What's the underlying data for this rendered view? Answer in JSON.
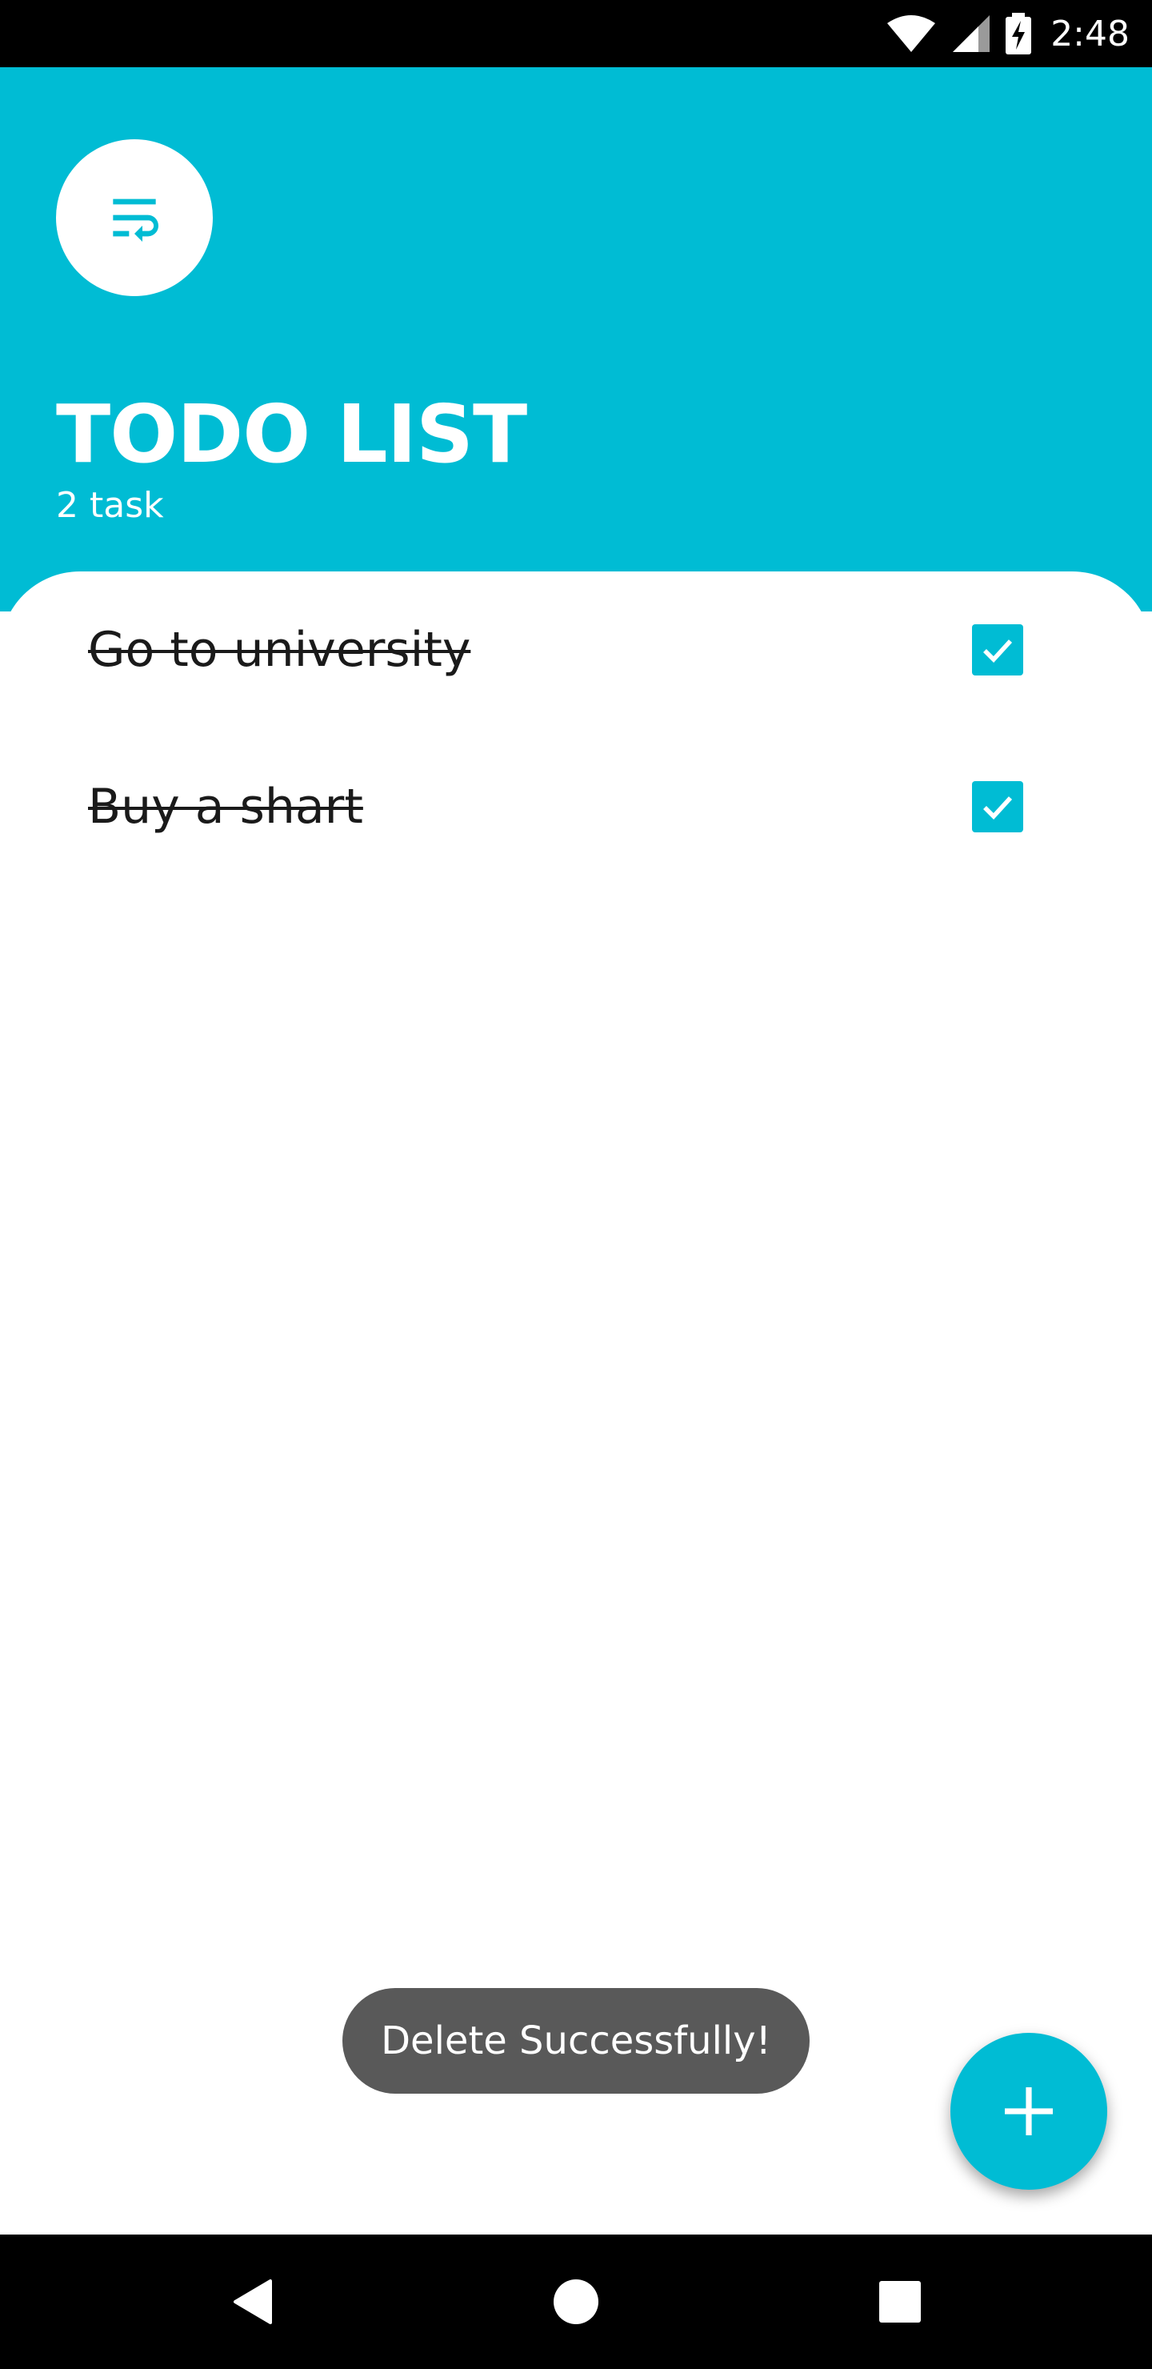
{
  "status_bar": {
    "time": "2:48",
    "icons": [
      "wifi-icon",
      "cellular-signal-icon",
      "battery-charging-icon"
    ]
  },
  "header": {
    "app_icon": "wrap-text-icon",
    "title": "TODO LIST",
    "task_count": "2 task",
    "accent_color": "#00bcd4"
  },
  "tasks": [
    {
      "label": "Go to university",
      "done": true
    },
    {
      "label": "Buy a shart",
      "done": true
    }
  ],
  "toast": {
    "message": "Delete Successfully!"
  },
  "fab": {
    "icon": "plus-icon"
  },
  "nav_bar": {
    "buttons": [
      "back-icon",
      "home-icon",
      "recents-icon"
    ]
  }
}
